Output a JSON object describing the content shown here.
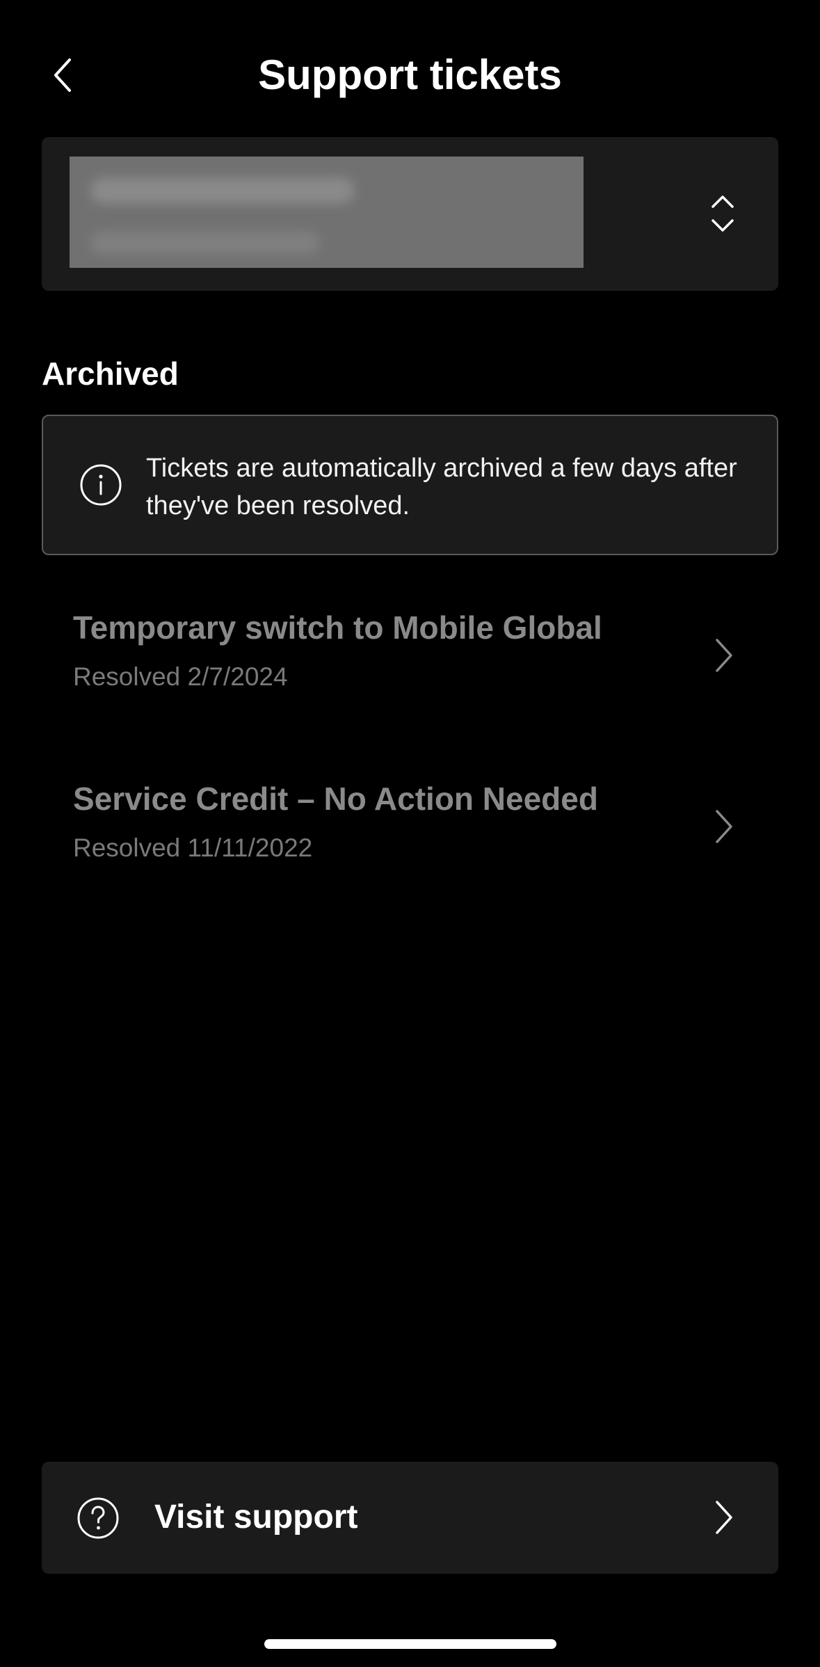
{
  "header": {
    "title": "Support tickets",
    "back_icon": "chevron-left-icon"
  },
  "account_selector": {
    "value_redacted": true,
    "icon": "chevron-up-down-icon"
  },
  "archived": {
    "heading": "Archived",
    "info_icon": "info-icon",
    "info_text": "Tickets are automatically archived a few days after they've been resolved.",
    "tickets": [
      {
        "title": "Temporary switch to Mobile Global",
        "status": "Resolved 2/7/2024"
      },
      {
        "title": "Service Credit – No Action Needed",
        "status": "Resolved 11/11/2022"
      }
    ]
  },
  "footer": {
    "visit_support_label": "Visit support",
    "help_icon": "question-circle-icon",
    "chevron_icon": "chevron-right-icon"
  },
  "colors": {
    "background": "#000000",
    "card": "#1b1b1b",
    "muted_text": "#8a8a8a",
    "redacted": "#717171"
  }
}
